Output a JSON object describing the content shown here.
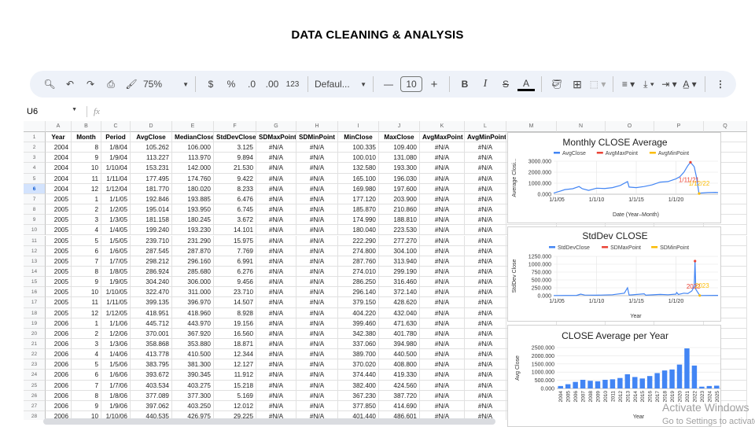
{
  "page_title": "DATA CLEANING & ANALYSIS",
  "toolbar": {
    "zoom": "75%",
    "format_number": "123",
    "font": "Defaul...",
    "font_size": "10",
    "currency": "$",
    "percent": "%",
    "dec_less": ".0",
    "dec_more": ".00"
  },
  "formula_bar": {
    "cell_ref": "U6",
    "fx": "fx",
    "value": ""
  },
  "columns": [
    "A",
    "B",
    "C",
    "D",
    "E",
    "F",
    "G",
    "H",
    "I",
    "J",
    "K",
    "L",
    "M",
    "N",
    "O",
    "P",
    "Q"
  ],
  "headers": [
    "Year",
    "Month",
    "Period",
    "AvgClose",
    "MedianClose",
    "StdDevClose",
    "SDMaxPoint",
    "SDMinPoint",
    "MinClose",
    "MaxClose",
    "AvgMaxPoint",
    "AvgMinPoint"
  ],
  "selected_row": 6,
  "rows": [
    [
      "2004",
      "8",
      "1/8/04",
      "105.262",
      "106.000",
      "3.125",
      "#N/A",
      "#N/A",
      "100.335",
      "109.400",
      "#N/A",
      "#N/A"
    ],
    [
      "2004",
      "9",
      "1/9/04",
      "113.227",
      "113.970",
      "9.894",
      "#N/A",
      "#N/A",
      "100.010",
      "131.080",
      "#N/A",
      "#N/A"
    ],
    [
      "2004",
      "10",
      "1/10/04",
      "153.231",
      "142.000",
      "21.530",
      "#N/A",
      "#N/A",
      "132.580",
      "193.300",
      "#N/A",
      "#N/A"
    ],
    [
      "2004",
      "11",
      "1/11/04",
      "177.495",
      "174.760",
      "9.422",
      "#N/A",
      "#N/A",
      "165.100",
      "196.030",
      "#N/A",
      "#N/A"
    ],
    [
      "2004",
      "12",
      "1/12/04",
      "181.770",
      "180.020",
      "8.233",
      "#N/A",
      "#N/A",
      "169.980",
      "197.600",
      "#N/A",
      "#N/A"
    ],
    [
      "2005",
      "1",
      "1/1/05",
      "192.846",
      "193.885",
      "6.476",
      "#N/A",
      "#N/A",
      "177.120",
      "203.900",
      "#N/A",
      "#N/A"
    ],
    [
      "2005",
      "2",
      "1/2/05",
      "195.014",
      "193.950",
      "6.745",
      "#N/A",
      "#N/A",
      "185.870",
      "210.860",
      "#N/A",
      "#N/A"
    ],
    [
      "2005",
      "3",
      "1/3/05",
      "181.158",
      "180.245",
      "3.672",
      "#N/A",
      "#N/A",
      "174.990",
      "188.810",
      "#N/A",
      "#N/A"
    ],
    [
      "2005",
      "4",
      "1/4/05",
      "199.240",
      "193.230",
      "14.101",
      "#N/A",
      "#N/A",
      "180.040",
      "223.530",
      "#N/A",
      "#N/A"
    ],
    [
      "2005",
      "5",
      "1/5/05",
      "239.710",
      "231.290",
      "15.975",
      "#N/A",
      "#N/A",
      "222.290",
      "277.270",
      "#N/A",
      "#N/A"
    ],
    [
      "2005",
      "6",
      "1/6/05",
      "287.545",
      "287.870",
      "7.769",
      "#N/A",
      "#N/A",
      "274.800",
      "304.100",
      "#N/A",
      "#N/A"
    ],
    [
      "2005",
      "7",
      "1/7/05",
      "298.212",
      "296.160",
      "6.991",
      "#N/A",
      "#N/A",
      "287.760",
      "313.940",
      "#N/A",
      "#N/A"
    ],
    [
      "2005",
      "8",
      "1/8/05",
      "286.924",
      "285.680",
      "6.276",
      "#N/A",
      "#N/A",
      "274.010",
      "299.190",
      "#N/A",
      "#N/A"
    ],
    [
      "2005",
      "9",
      "1/9/05",
      "304.240",
      "306.000",
      "9.456",
      "#N/A",
      "#N/A",
      "286.250",
      "316.460",
      "#N/A",
      "#N/A"
    ],
    [
      "2005",
      "10",
      "1/10/05",
      "322.470",
      "311.000",
      "23.710",
      "#N/A",
      "#N/A",
      "296.140",
      "372.140",
      "#N/A",
      "#N/A"
    ],
    [
      "2005",
      "11",
      "1/11/05",
      "399.135",
      "396.970",
      "14.507",
      "#N/A",
      "#N/A",
      "379.150",
      "428.620",
      "#N/A",
      "#N/A"
    ],
    [
      "2005",
      "12",
      "1/12/05",
      "418.951",
      "418.960",
      "8.928",
      "#N/A",
      "#N/A",
      "404.220",
      "432.040",
      "#N/A",
      "#N/A"
    ],
    [
      "2006",
      "1",
      "1/1/06",
      "445.712",
      "443.970",
      "19.156",
      "#N/A",
      "#N/A",
      "399.460",
      "471.630",
      "#N/A",
      "#N/A"
    ],
    [
      "2006",
      "2",
      "1/2/06",
      "370.001",
      "367.920",
      "16.560",
      "#N/A",
      "#N/A",
      "342.380",
      "401.780",
      "#N/A",
      "#N/A"
    ],
    [
      "2006",
      "3",
      "1/3/06",
      "358.868",
      "353.880",
      "18.871",
      "#N/A",
      "#N/A",
      "337.060",
      "394.980",
      "#N/A",
      "#N/A"
    ],
    [
      "2006",
      "4",
      "1/4/06",
      "413.778",
      "410.500",
      "12.344",
      "#N/A",
      "#N/A",
      "389.700",
      "440.500",
      "#N/A",
      "#N/A"
    ],
    [
      "2006",
      "5",
      "1/5/06",
      "383.795",
      "381.300",
      "12.127",
      "#N/A",
      "#N/A",
      "370.020",
      "408.800",
      "#N/A",
      "#N/A"
    ],
    [
      "2006",
      "6",
      "1/6/06",
      "393.672",
      "390.345",
      "11.912",
      "#N/A",
      "#N/A",
      "374.440",
      "419.330",
      "#N/A",
      "#N/A"
    ],
    [
      "2006",
      "7",
      "1/7/06",
      "403.534",
      "403.275",
      "15.218",
      "#N/A",
      "#N/A",
      "382.400",
      "424.560",
      "#N/A",
      "#N/A"
    ],
    [
      "2006",
      "8",
      "1/8/06",
      "377.089",
      "377.300",
      "5.169",
      "#N/A",
      "#N/A",
      "367.230",
      "387.720",
      "#N/A",
      "#N/A"
    ],
    [
      "2006",
      "9",
      "1/9/06",
      "397.062",
      "403.250",
      "12.012",
      "#N/A",
      "#N/A",
      "377.850",
      "414.690",
      "#N/A",
      "#N/A"
    ],
    [
      "2006",
      "10",
      "1/10/06",
      "440.535",
      "426.975",
      "29.225",
      "#N/A",
      "#N/A",
      "401.440",
      "486.601",
      "#N/A",
      "#N/A"
    ]
  ],
  "chart_data": [
    {
      "type": "line",
      "title": "Monthly CLOSE Average",
      "xlabel": "Date (Year–Month)",
      "ylabel": "Average Closi...",
      "legend": [
        "AvgClose",
        "AvgMaxPoint",
        "AvgMinPoint"
      ],
      "legend_position": "top",
      "colors": [
        "#4285f4",
        "#ea4335",
        "#fbbc04"
      ],
      "yticks": [
        "0.000",
        "1000.000",
        "2000.000",
        "3000.000"
      ],
      "ylim": [
        0,
        3000
      ],
      "xticks": [
        "1/1/05",
        "1/1/10",
        "1/1/15",
        "1/1/20"
      ],
      "xtick_values": [
        2005,
        2010,
        2015,
        2020
      ],
      "xlim": [
        2004.6,
        2025.3
      ],
      "x": [
        2004.6,
        2005,
        2005.5,
        2006,
        2007,
        2007.8,
        2008.2,
        2009,
        2010,
        2011,
        2012,
        2013,
        2013.9,
        2014.1,
        2015,
        2016,
        2017,
        2018,
        2019,
        2020,
        2020.5,
        2021,
        2021.5,
        2021.83,
        2022.3,
        2022.6,
        2022.9,
        2023,
        2024,
        2025,
        2025.3
      ],
      "y": [
        105,
        190,
        300,
        420,
        500,
        700,
        500,
        350,
        550,
        520,
        600,
        800,
        1150,
        650,
        600,
        700,
        850,
        1100,
        1150,
        1400,
        1600,
        2000,
        2600,
        2900,
        2500,
        1500,
        60,
        100,
        150,
        170,
        150
      ],
      "max_point": {
        "x": 2021.83,
        "y": 2900,
        "label": "1/11/21"
      },
      "min_point": {
        "x": 2022.92,
        "y": 60,
        "label": "1/12/22"
      }
    },
    {
      "type": "line",
      "title": "StdDev CLOSE",
      "xlabel": "Year",
      "ylabel": "StdDev Close",
      "legend": [
        "StdDevClose",
        "SDMaxPoint",
        "SDMinPoint"
      ],
      "legend_position": "top",
      "colors": [
        "#4285f4",
        "#ea4335",
        "#fbbc04"
      ],
      "yticks": [
        "0.000",
        "250.000",
        "500.000",
        "750.000",
        "1000.000",
        "1250.000"
      ],
      "ylim": [
        0,
        1250
      ],
      "xticks": [
        "1/1/05",
        "1/1/10",
        "1/1/15",
        "1/1/20"
      ],
      "xtick_values": [
        2005,
        2010,
        2015,
        2020
      ],
      "xlim": [
        2004.6,
        2025.3
      ],
      "x": [
        2004.6,
        2007.5,
        2008,
        2008.5,
        2010,
        2012,
        2013.5,
        2013.9,
        2014.1,
        2016,
        2016.2,
        2018,
        2019,
        2020,
        2020.1,
        2020.3,
        2021,
        2021.5,
        2022,
        2022.3,
        2022.4,
        2022.5,
        2023,
        2025.3
      ],
      "y": [
        5,
        10,
        50,
        20,
        15,
        30,
        80,
        250,
        20,
        60,
        15,
        40,
        30,
        50,
        100,
        40,
        80,
        70,
        150,
        300,
        1100,
        200,
        5,
        10
      ],
      "max_point": {
        "x": 2022.4,
        "y": 1100,
        "label": "2022"
      },
      "min_point": {
        "x": 2023,
        "y": 5,
        "label": "2023"
      }
    },
    {
      "type": "bar",
      "title": "CLOSE Average per Year",
      "xlabel": "Year",
      "ylabel": "Avg Close",
      "color": "#4285f4",
      "yticks": [
        "0.000",
        "500.000",
        "1000.000",
        "1500.000",
        "2000.000",
        "2500.000"
      ],
      "ylim": [
        0,
        2500
      ],
      "categories": [
        "2004",
        "2005",
        "2006",
        "2007",
        "2008",
        "2009",
        "2010",
        "2011",
        "2012",
        "2013",
        "2014",
        "2015",
        "2016",
        "2017",
        "2018",
        "2019",
        "2020",
        "2021",
        "2022",
        "2023",
        "2024",
        "2025"
      ],
      "values": [
        150,
        260,
        400,
        530,
        470,
        440,
        530,
        560,
        640,
        870,
        700,
        610,
        760,
        940,
        1100,
        1160,
        1460,
        2450,
        1400,
        110,
        150,
        170
      ]
    }
  ],
  "watermark": {
    "line1": "Activate Windows",
    "line2": "Go to Settings to activate Windows."
  }
}
